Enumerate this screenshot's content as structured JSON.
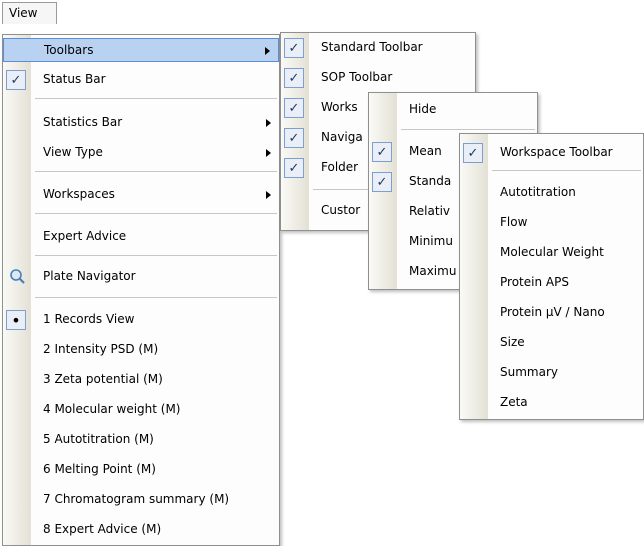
{
  "menubar": {
    "view_label": "View"
  },
  "view_menu": {
    "toolbars": "Toolbars",
    "status_bar": "Status Bar",
    "statistics_bar": "Statistics Bar",
    "view_type": "View Type",
    "workspaces": "Workspaces",
    "expert_advice": "Expert Advice",
    "plate_navigator": "Plate Navigator",
    "records": [
      "1 Records View",
      "2 Intensity PSD (M)",
      "3 Zeta potential (M)",
      "4 Molecular weight (M)",
      "5 Autotitration (M)",
      "6 Melting Point (M)",
      "7 Chromatogram summary (M)",
      "8 Expert Advice (M)"
    ]
  },
  "toolbars_menu": {
    "items": [
      "Standard Toolbar",
      "SOP Toolbar",
      "Works",
      "Naviga",
      "Folder",
      "Custor"
    ]
  },
  "statistics_menu": {
    "items": [
      "Hide",
      "Mean",
      "Standa",
      "Relativ",
      "Minimu",
      "Maximu"
    ]
  },
  "workspaces_menu": {
    "items": [
      "Workspace Toolbar",
      "Autotitration",
      "Flow",
      "Molecular Weight",
      "Protein APS",
      "Protein µV / Nano",
      "Size",
      "Summary",
      "Zeta"
    ]
  },
  "colors": {
    "highlight": "#b9d2f1",
    "highlight_border": "#5a8fd6",
    "check_box": "#e9eef7"
  }
}
